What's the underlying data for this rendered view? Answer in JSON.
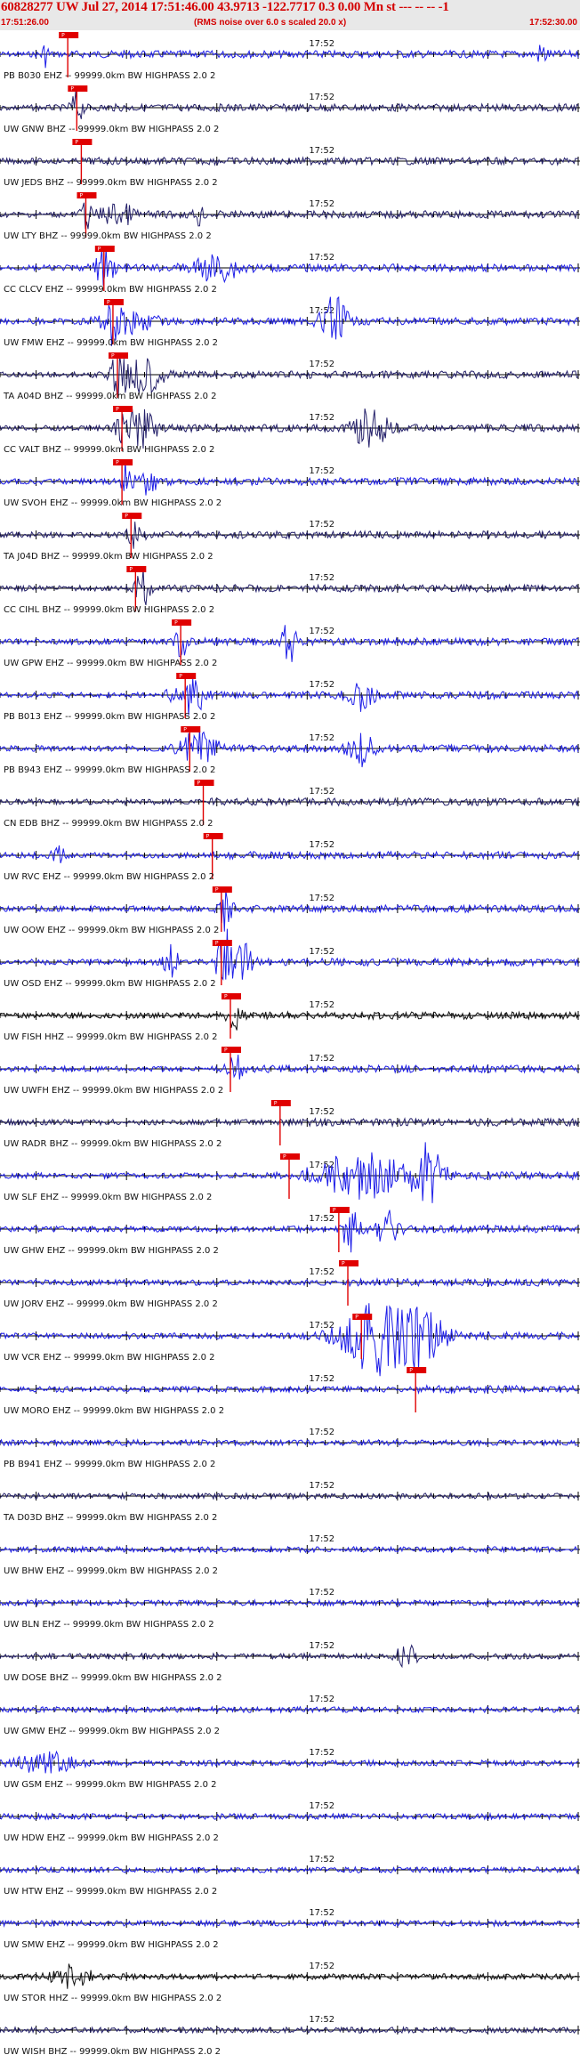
{
  "header": {
    "title": "60828277 UW Jul 27, 2014 17:51:46.00   43.9713 -122.7717  0.3 0.00 Mn st --- -- --  -1",
    "start_time": "17:51:26.00",
    "rms_note": "(RMS noise over 6.0 s scaled 20.0 x)",
    "end_time": "17:52:30.00"
  },
  "colors": {
    "header_text": "#d40000",
    "header_bg": "#e8e8e8",
    "trace_blue": "#1f1fe8",
    "trace_navy": "#24206a",
    "trace_black": "#101010",
    "pick": "#e00000",
    "grid": "#000000"
  },
  "chart_data": {
    "type": "seismogram",
    "x_start": "17:51:26.00",
    "x_end": "17:52:30.00",
    "minute_mark": "17:52",
    "pick_label": "P",
    "traces": [
      {
        "label": "PB B030 EHZ -- 99999.0km BW HIGHPASS 2.0 2",
        "color": "blue",
        "pick_s": 7.5,
        "events": [
          [
            5,
            0.5,
            1.4
          ],
          [
            60,
            0.7,
            1.3
          ]
        ]
      },
      {
        "label": "UW GNW BHZ -- 99999.0km BW HIGHPASS 2.0 2",
        "color": "navy",
        "pick_s": 8.5,
        "events": [
          [
            8.5,
            0.7,
            2
          ]
        ]
      },
      {
        "label": "UW JEDS BHZ -- 99999.0km BW HIGHPASS 2.0 2",
        "color": "navy",
        "pick_s": 9.0,
        "events": []
      },
      {
        "label": "UW LTY BHZ -- 99999.0km BW HIGHPASS 2.0 2",
        "color": "navy",
        "pick_s": 9.5,
        "events": [
          [
            9.5,
            0.6,
            1.8
          ],
          [
            22,
            0.5,
            1.6
          ],
          [
            13,
            2,
            1.4
          ]
        ]
      },
      {
        "label": "CC CLCV EHZ -- 99999.0km BW HIGHPASS 2.0 2",
        "color": "blue",
        "pick_s": 11.5,
        "events": [
          [
            11.5,
            1,
            2.5
          ],
          [
            24,
            3,
            1.6
          ]
        ]
      },
      {
        "label": "UW FMW EHZ -- 99999.0km BW HIGHPASS 2.0 2",
        "color": "blue",
        "pick_s": 12.5,
        "events": [
          [
            12.5,
            1,
            3.5
          ],
          [
            37,
            1.5,
            3
          ],
          [
            14,
            3,
            1.5
          ]
        ]
      },
      {
        "label": "TA A04D BHZ -- 99999.0km BW HIGHPASS 2.0 2",
        "color": "navy",
        "pick_s": 13.0,
        "events": [
          [
            13.5,
            1.5,
            3
          ],
          [
            16,
            2,
            2.2
          ]
        ]
      },
      {
        "label": "CC VALT BHZ -- 99999.0km BW HIGHPASS 2.0 2",
        "color": "navy",
        "pick_s": 13.5,
        "events": [
          [
            15,
            2,
            3
          ],
          [
            41,
            2,
            2.5
          ]
        ]
      },
      {
        "label": "UW SVOH EHZ -- 99999.0km BW HIGHPASS 2.0 2",
        "color": "blue",
        "pick_s": 13.5,
        "events": [
          [
            14,
            0.5,
            2.5
          ],
          [
            16,
            1.5,
            1.4
          ]
        ]
      },
      {
        "label": "TA J04D BHZ -- 99999.0km BW HIGHPASS 2.0 2",
        "color": "navy",
        "pick_s": 14.5,
        "events": [
          [
            15,
            0.8,
            1.8
          ]
        ]
      },
      {
        "label": "CC CIHL BHZ -- 99999.0km BW HIGHPASS 2.0 2",
        "color": "navy",
        "pick_s": 15.0,
        "events": [
          [
            15.8,
            0.8,
            2.2
          ]
        ]
      },
      {
        "label": "UW GPW EHZ -- 99999.0km BW HIGHPASS 2.0 2",
        "color": "blue",
        "pick_s": 20.0,
        "events": [
          [
            20,
            0.6,
            2.2
          ],
          [
            32,
            0.7,
            3
          ]
        ]
      },
      {
        "label": "PB B013 EHZ -- 99999.0km BW HIGHPASS 2.0 2",
        "color": "blue",
        "pick_s": 20.5,
        "events": [
          [
            21,
            2,
            2.2
          ],
          [
            40,
            1.5,
            1.8
          ]
        ]
      },
      {
        "label": "PB B943 EHZ -- 99999.0km BW HIGHPASS 2.0 2",
        "color": "blue",
        "pick_s": 21.0,
        "events": [
          [
            22,
            2,
            2.5
          ],
          [
            40,
            1.5,
            2
          ]
        ]
      },
      {
        "label": "CN EDB BHZ -- 99999.0km BW HIGHPASS 2.0 2",
        "color": "navy",
        "pick_s": 22.5,
        "events": []
      },
      {
        "label": "UW RVC EHZ -- 99999.0km BW HIGHPASS 2.0 2",
        "color": "blue",
        "pick_s": 23.5,
        "events": [
          [
            6.5,
            0.6,
            1.5
          ]
        ]
      },
      {
        "label": "UW OOW EHZ -- 99999.0km BW HIGHPASS 2.0 2",
        "color": "blue",
        "pick_s": 24.5,
        "events": [
          [
            25,
            0.7,
            3
          ]
        ]
      },
      {
        "label": "UW OSD EHZ -- 99999.0km BW HIGHPASS 2.0 2",
        "color": "blue",
        "pick_s": 24.5,
        "events": [
          [
            25,
            1,
            4
          ],
          [
            27,
            1,
            2.5
          ],
          [
            19,
            0.8,
            2
          ]
        ]
      },
      {
        "label": "UW FISH HHZ -- 99999.0km BW HIGHPASS 2.0 2",
        "color": "black",
        "pick_s": 25.5,
        "events": [
          [
            26,
            0.8,
            1.6
          ]
        ]
      },
      {
        "label": "UW UWFH EHZ -- 99999.0km BW HIGHPASS 2.0 2",
        "color": "blue",
        "pick_s": 25.5,
        "events": [
          [
            26,
            0.8,
            1.8
          ]
        ]
      },
      {
        "label": "UW RADR BHZ -- 99999.0km BW HIGHPASS 2.0 2",
        "color": "navy",
        "pick_s": 31.0,
        "events": []
      },
      {
        "label": "UW SLF EHZ -- 99999.0km BW HIGHPASS 2.0 2",
        "color": "blue",
        "pick_s": 32.0,
        "events": [
          [
            40,
            5,
            3
          ],
          [
            47,
            2,
            4
          ]
        ]
      },
      {
        "label": "UW GHW EHZ -- 99999.0km BW HIGHPASS 2.0 2",
        "color": "blue",
        "pick_s": 37.5,
        "events": [
          [
            39,
            1,
            3.2
          ],
          [
            43,
            1.2,
            2.5
          ]
        ]
      },
      {
        "label": "UW JORV EHZ -- 99999.0km BW HIGHPASS 2.0 2",
        "color": "blue",
        "pick_s": 38.5,
        "events": []
      },
      {
        "label": "UW VCR EHZ -- 99999.0km BW HIGHPASS 2.0 2",
        "color": "blue",
        "pick_s": 40.0,
        "events": [
          [
            42,
            4,
            5
          ],
          [
            46,
            3,
            4
          ]
        ]
      },
      {
        "label": "UW MORO EHZ -- 99999.0km BW HIGHPASS 2.0 2",
        "color": "blue",
        "pick_s": 46.0,
        "events": []
      },
      {
        "label": "PB B941 EHZ -- 99999.0km BW HIGHPASS 2.0 2",
        "color": "blue",
        "pick_s": null,
        "events": []
      },
      {
        "label": "TA D03D BHZ -- 99999.0km BW HIGHPASS 2.0 2",
        "color": "navy",
        "pick_s": null,
        "events": []
      },
      {
        "label": "UW BHW EHZ -- 99999.0km BW HIGHPASS 2.0 2",
        "color": "blue",
        "pick_s": null,
        "events": []
      },
      {
        "label": "UW BLN EHZ -- 99999.0km BW HIGHPASS 2.0 2",
        "color": "blue",
        "pick_s": null,
        "events": []
      },
      {
        "label": "UW DOSE BHZ -- 99999.0km BW HIGHPASS 2.0 2",
        "color": "navy",
        "pick_s": null,
        "events": [
          [
            45,
            1,
            1.6
          ]
        ]
      },
      {
        "label": "UW GMW EHZ -- 99999.0km BW HIGHPASS 2.0 2",
        "color": "blue",
        "pick_s": null,
        "events": []
      },
      {
        "label": "UW GSM EHZ -- 99999.0km BW HIGHPASS 2.0 2",
        "color": "blue",
        "pick_s": null,
        "events": [
          [
            5,
            3,
            1.3
          ]
        ]
      },
      {
        "label": "UW HDW EHZ -- 99999.0km BW HIGHPASS 2.0 2",
        "color": "blue",
        "pick_s": null,
        "events": []
      },
      {
        "label": "UW HTW EHZ -- 99999.0km BW HIGHPASS 2.0 2",
        "color": "blue",
        "pick_s": null,
        "events": []
      },
      {
        "label": "UW SMW EHZ -- 99999.0km BW HIGHPASS 2.0 2",
        "color": "blue",
        "pick_s": null,
        "events": []
      },
      {
        "label": "UW STOR HHZ -- 99999.0km BW HIGHPASS 2.0 2",
        "color": "black",
        "pick_s": null,
        "events": [
          [
            8,
            2,
            1.4
          ]
        ]
      },
      {
        "label": "UW WISH BHZ -- 99999.0km BW HIGHPASS 2.0 2",
        "color": "navy",
        "pick_s": null,
        "events": []
      }
    ]
  }
}
